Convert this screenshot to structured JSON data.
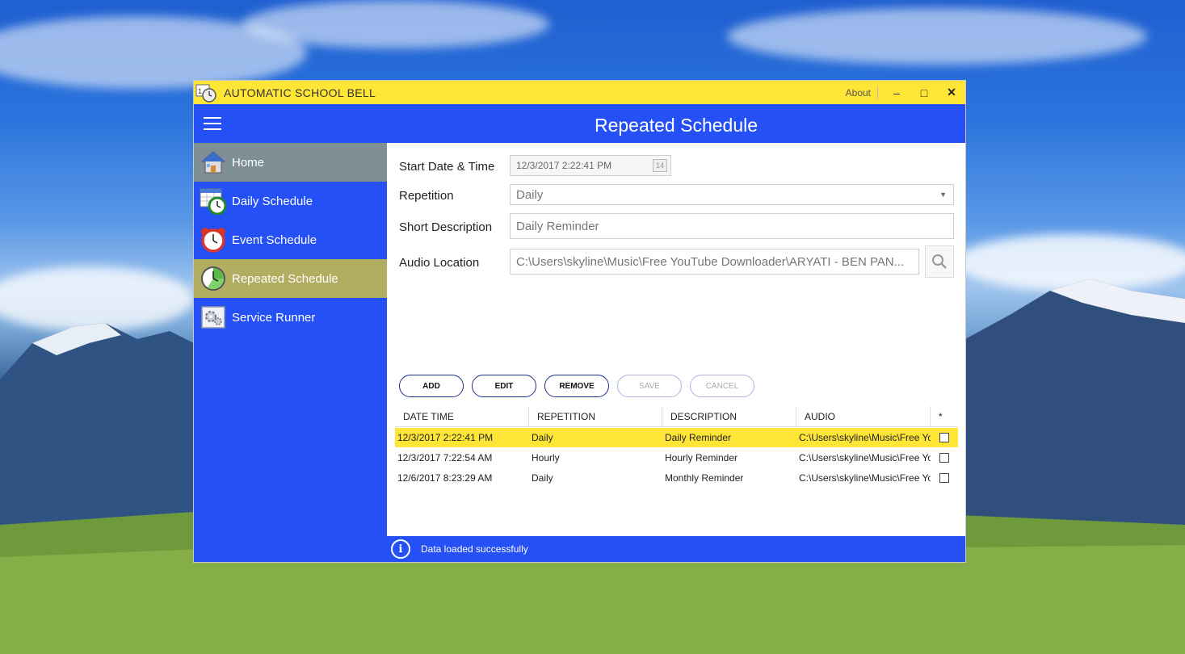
{
  "window": {
    "title": "AUTOMATIC SCHOOL BELL",
    "about_label": "About",
    "minimize_glyph": "‒",
    "maximize_glyph": "□",
    "close_glyph": "✕"
  },
  "header": {
    "title": "Repeated Schedule"
  },
  "sidebar": {
    "items": [
      {
        "label": "Home",
        "icon": "home-icon"
      },
      {
        "label": "Daily Schedule",
        "icon": "calendar-clock-icon"
      },
      {
        "label": "Event Schedule",
        "icon": "alarm-clock-icon"
      },
      {
        "label": "Repeated Schedule",
        "icon": "repeat-clock-icon"
      },
      {
        "label": "Service Runner",
        "icon": "service-gear-icon"
      }
    ],
    "active_index": 3
  },
  "form": {
    "start_label": "Start Date & Time",
    "start_value": "12/3/2017 2:22:41 PM",
    "repetition_label": "Repetition",
    "repetition_value": "Daily",
    "description_label": "Short Description",
    "description_value": "Daily Reminder",
    "audio_label": "Audio Location",
    "audio_value": "C:\\Users\\skyline\\Music\\Free YouTube Downloader\\ARYATI - BEN PAN..."
  },
  "buttons": {
    "add": "ADD",
    "edit": "EDIT",
    "remove": "REMOVE",
    "save": "SAVE",
    "cancel": "CANCEL"
  },
  "grid": {
    "columns": [
      "DATE TIME",
      "REPETITION",
      "DESCRIPTION",
      "AUDIO",
      "*"
    ],
    "rows": [
      {
        "datetime": "12/3/2017 2:22:41 PM",
        "repetition": "Daily",
        "description": "Daily Reminder",
        "audio": "C:\\Users\\skyline\\Music\\Free Yo",
        "checked": false
      },
      {
        "datetime": "12/3/2017 7:22:54 AM",
        "repetition": "Hourly",
        "description": "Hourly Reminder",
        "audio": "C:\\Users\\skyline\\Music\\Free Yo",
        "checked": false
      },
      {
        "datetime": "12/6/2017 8:23:29 AM",
        "repetition": "Daily",
        "description": "Monthly Reminder",
        "audio": "C:\\Users\\skyline\\Music\\Free Yo",
        "checked": false
      }
    ],
    "selected_index": 0
  },
  "status": {
    "message": "Data loaded successfully",
    "icon": "info-icon"
  },
  "colors": {
    "accent": "#2450f5",
    "titlebar": "#ffe535",
    "active_nav": "#b3ad62",
    "home_nav": "#7e8f95"
  }
}
